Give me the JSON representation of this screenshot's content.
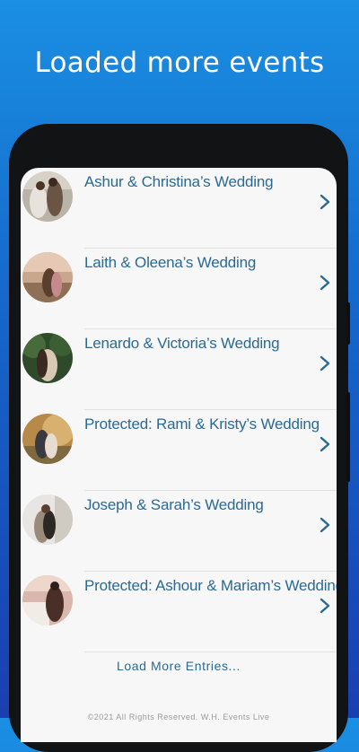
{
  "headline": "Loaded more events",
  "events": [
    {
      "title": "Ashur & Christina’s Wedding",
      "photo": "couple-photo-icon"
    },
    {
      "title": "Laith & Oleena’s Wedding",
      "photo": "couple-photo-icon"
    },
    {
      "title": "Lenardo & Victoria’s Wedding",
      "photo": "couple-photo-icon"
    },
    {
      "title": "Protected: Rami & Kristy’s Wedding",
      "photo": "couple-photo-icon"
    },
    {
      "title": "Joseph & Sarah’s Wedding",
      "photo": "couple-photo-icon"
    },
    {
      "title": "Protected: Ashour & Mariam’s Wedding",
      "photo": "couple-photo-icon"
    }
  ],
  "load_more_label": "Load More Entries...",
  "footer_text": "©2021 All Rights Reserved. W.H. Events Live",
  "colors": {
    "accent": "#2a6a92",
    "background_top": "#1a8fe3",
    "background_bottom": "#1a3fb0"
  }
}
